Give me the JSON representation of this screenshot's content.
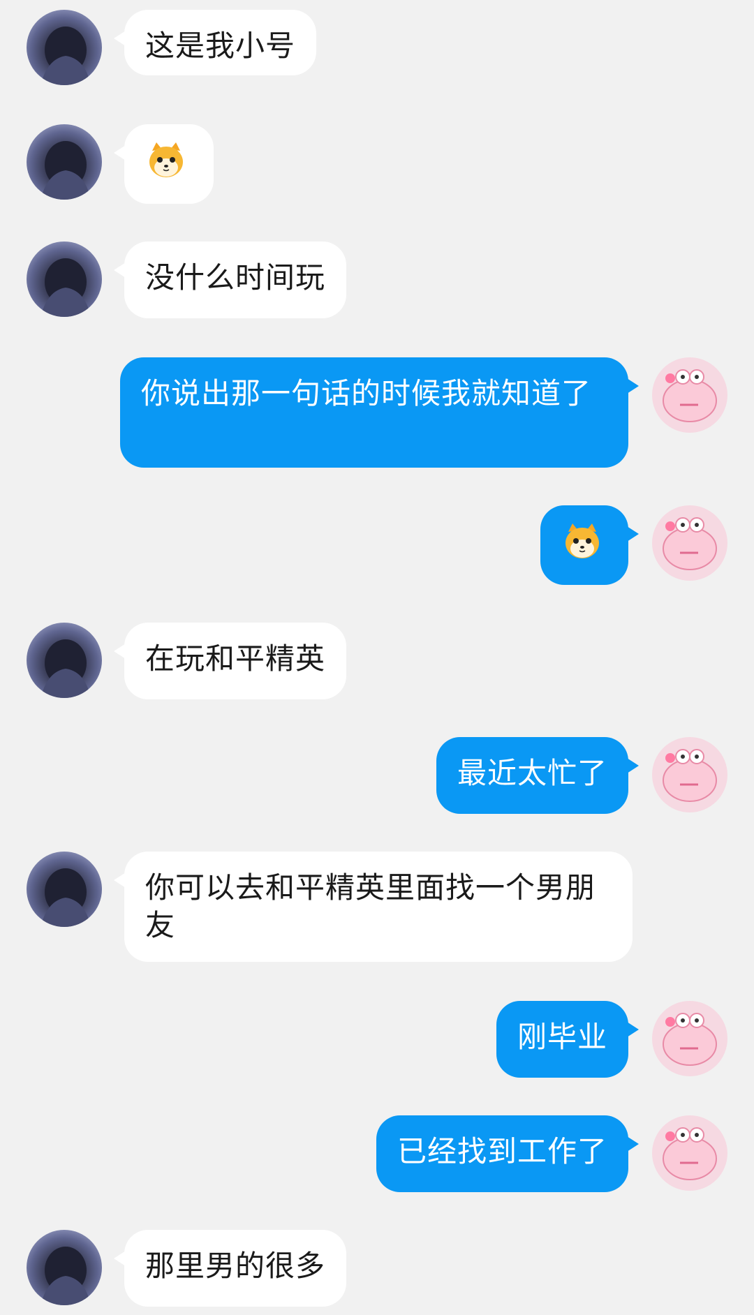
{
  "messages": [
    {
      "side": "left",
      "text": "这是我小号"
    },
    {
      "side": "left",
      "emoji": "shiba-dog-emoji"
    },
    {
      "side": "left",
      "text": "没什么时间玩"
    },
    {
      "side": "right",
      "text": "你说出那一句话的时候我就知道了"
    },
    {
      "side": "right",
      "emoji": "shiba-dog-emoji"
    },
    {
      "side": "left",
      "text": "在玩和平精英"
    },
    {
      "side": "right",
      "text": "最近太忙了"
    },
    {
      "side": "left",
      "text": "你可以去和平精英里面找一个男朋友"
    },
    {
      "side": "right",
      "text": "刚毕业"
    },
    {
      "side": "right",
      "text": "已经找到工作了"
    },
    {
      "side": "left",
      "text": "那里男的很多"
    }
  ],
  "colors": {
    "background": "#f1f1f1",
    "incoming_bubble": "#ffffff",
    "outgoing_bubble": "#0a98f4",
    "outgoing_text": "#ffffff",
    "incoming_text": "#1a1a1a"
  },
  "avatars": {
    "them": "dark-hair-person-avatar",
    "me": "pink-frog-avatar"
  }
}
